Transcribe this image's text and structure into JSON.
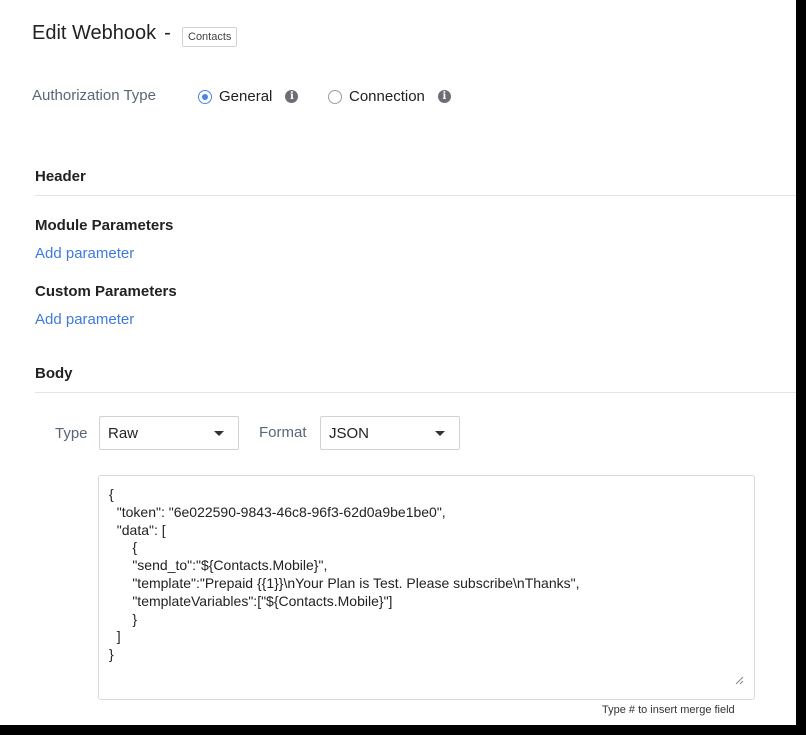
{
  "header": {
    "title": "Edit Webhook",
    "separator": "-",
    "module_badge": "Contacts"
  },
  "authorization": {
    "label": "Authorization Type",
    "options": [
      {
        "label": "General",
        "selected": true,
        "info_icon": "info-icon"
      },
      {
        "label": "Connection",
        "selected": false,
        "info_icon": "info-icon"
      }
    ]
  },
  "sections": {
    "header_title": "Header",
    "module_params_title": "Module Parameters",
    "module_params_link": "Add parameter",
    "custom_params_title": "Custom Parameters",
    "custom_params_link": "Add parameter",
    "body_title": "Body"
  },
  "body": {
    "type_label": "Type",
    "type_value": "Raw",
    "format_label": "Format",
    "format_value": "JSON",
    "content": "{\n  \"token\": \"6e022590-9843-46c8-96f3-62d0a9be1be0\",\n  \"data\": [\n      {\n      \"send_to\":\"${Contacts.Mobile}\",\n      \"template\":\"Prepaid {{1}}\\nYour Plan is Test. Please subscribe\\nThanks\",\n      \"templateVariables\":[\"${Contacts.Mobile}\"]\n      }\n  ]\n}",
    "hint": "Type # to insert merge field"
  },
  "colors": {
    "accent": "#4a86e8",
    "link": "#3f7ae0",
    "muted_label": "#5a6577"
  }
}
